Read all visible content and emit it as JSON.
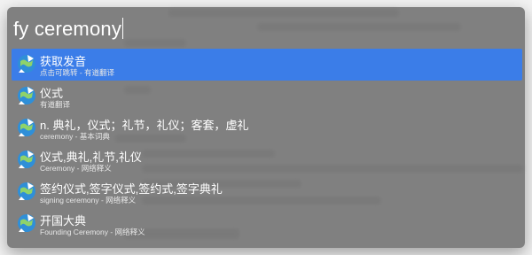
{
  "query": "fy ceremony",
  "results": [
    {
      "title": "获取发音",
      "subtitle": "点击可跳转 - 有道翻译",
      "selected": true
    },
    {
      "title": "仪式",
      "subtitle": "有道翻译",
      "selected": false
    },
    {
      "title": "n. 典礼，仪式；礼节，礼仪；客套，虚礼",
      "subtitle": "ceremony - 基本词典",
      "selected": false
    },
    {
      "title": "仪式,典礼,礼节,礼仪",
      "subtitle": "Ceremony - 网络释义",
      "selected": false
    },
    {
      "title": "签约仪式,签字仪式,签约式,签字典礼",
      "subtitle": "signing ceremony - 网络释义",
      "selected": false
    },
    {
      "title": "开国大典",
      "subtitle": "Founding Ceremony - 网络释义",
      "selected": false
    }
  ],
  "colors": {
    "selection": "#3b7de8",
    "panel": "#6e6e6e"
  },
  "icon": "youdao-translate-globe-icon"
}
